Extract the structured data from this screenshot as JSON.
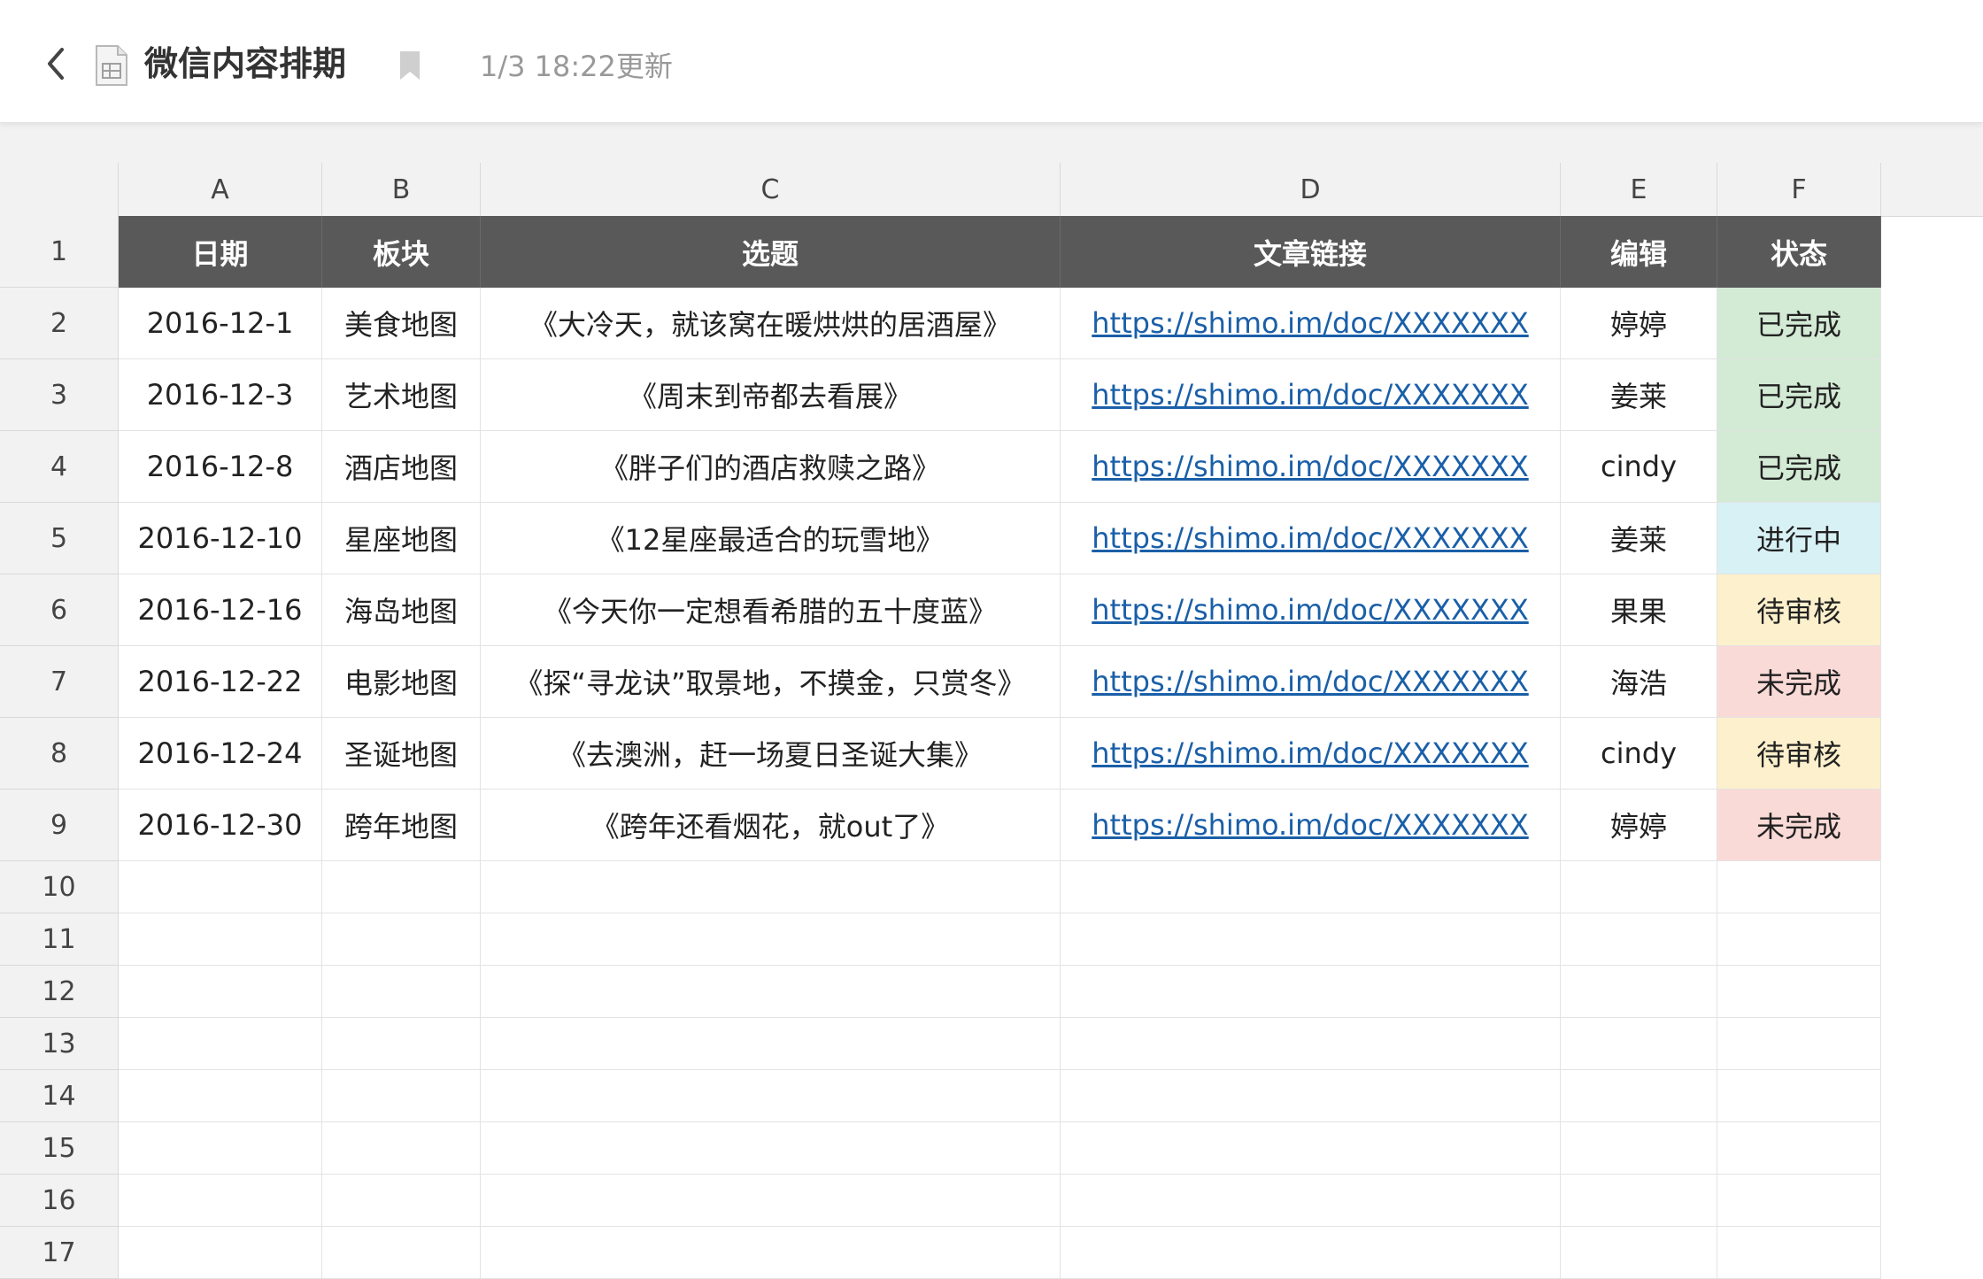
{
  "header": {
    "title": "微信内容排期",
    "updated": "1/3 18:22更新"
  },
  "columns": [
    "A",
    "B",
    "C",
    "D",
    "E",
    "F"
  ],
  "row_numbers": [
    "1",
    "2",
    "3",
    "4",
    "5",
    "6",
    "7",
    "8",
    "9",
    "10",
    "11",
    "12",
    "13",
    "14",
    "15",
    "16",
    "17"
  ],
  "table": {
    "headers": [
      "日期",
      "板块",
      "选题",
      "文章链接",
      "编辑",
      "状态"
    ],
    "rows": [
      {
        "date": "2016-12-1",
        "section": "美食地图",
        "topic": "《大冷天，就该窝在暖烘烘的居酒屋》",
        "link": "https://shimo.im/doc/XXXXXXX",
        "editor": "婷婷",
        "status": "已完成"
      },
      {
        "date": "2016-12-3",
        "section": "艺术地图",
        "topic": "《周末到帝都去看展》",
        "link": "https://shimo.im/doc/XXXXXXX",
        "editor": "姜莱",
        "status": "已完成"
      },
      {
        "date": "2016-12-8",
        "section": "酒店地图",
        "topic": "《胖子们的酒店救赎之路》",
        "link": "https://shimo.im/doc/XXXXXXX",
        "editor": "cindy",
        "status": "已完成"
      },
      {
        "date": "2016-12-10",
        "section": "星座地图",
        "topic": "《12星座最适合的玩雪地》",
        "link": "https://shimo.im/doc/XXXXXXX",
        "editor": "姜莱",
        "status": "进行中"
      },
      {
        "date": "2016-12-16",
        "section": "海岛地图",
        "topic": "《今天你一定想看希腊的五十度蓝》",
        "link": "https://shimo.im/doc/XXXXXXX",
        "editor": "果果",
        "status": "待审核"
      },
      {
        "date": "2016-12-22",
        "section": "电影地图",
        "topic": "《探“寻龙诀”取景地，不摸金，只赏冬》",
        "link": "https://shimo.im/doc/XXXXXXX",
        "editor": "海浩",
        "status": "未完成"
      },
      {
        "date": "2016-12-24",
        "section": "圣诞地图",
        "topic": "《去澳洲，赶一场夏日圣诞大集》",
        "link": "https://shimo.im/doc/XXXXXXX",
        "editor": "cindy",
        "status": "待审核"
      },
      {
        "date": "2016-12-30",
        "section": "跨年地图",
        "topic": "《跨年还看烟花，就out了》",
        "link": "https://shimo.im/doc/XXXXXXX",
        "editor": "婷婷",
        "status": "未完成"
      }
    ]
  },
  "status_colors": {
    "已完成": "#d3ead5",
    "进行中": "#d8f1f5",
    "待审核": "#fdf0cc",
    "未完成": "#fadad7"
  },
  "colors": {
    "header_bg": "#595959",
    "link": "#1a5fa8"
  },
  "icons": {
    "back": "chevron-left-icon",
    "doc": "spreadsheet-doc-icon",
    "bookmark": "bookmark-icon"
  }
}
